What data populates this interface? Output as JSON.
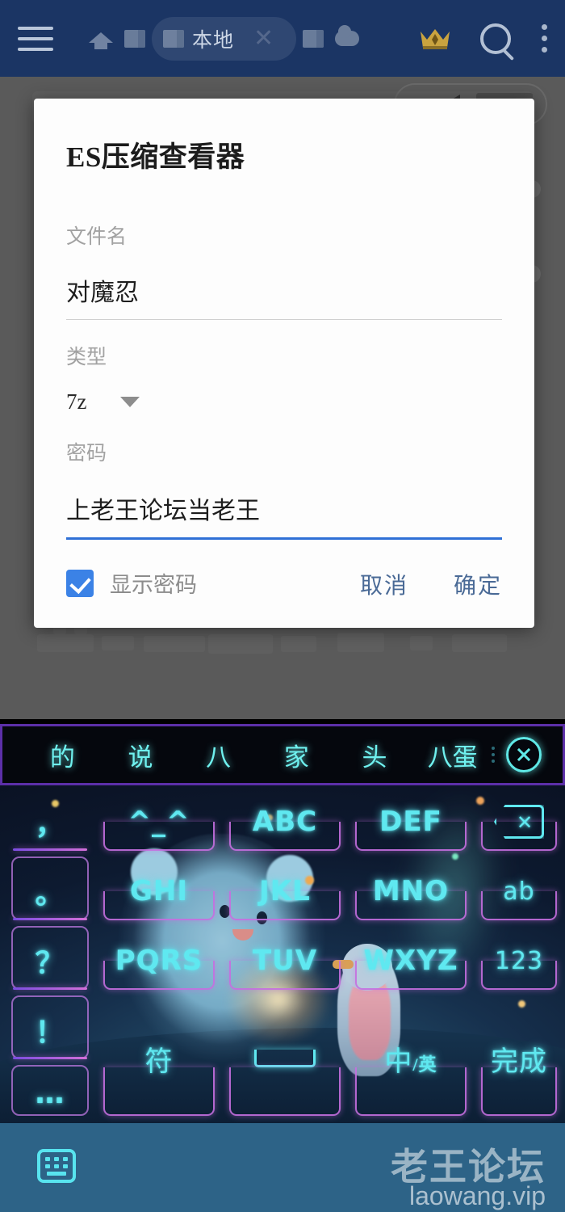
{
  "appbar": {
    "menu_icon": "hamburger-icon",
    "home_icon": "home-icon",
    "tab_icon": "tab-icon",
    "active_tab_label": "本地",
    "close_tab_icon": "close-icon",
    "cloud_icon": "cloud-icon",
    "premium_icon": "crown-icon",
    "search_icon": "search-icon",
    "overflow_icon": "more-vertical-icon",
    "bg_color": "#1b3564"
  },
  "dialog": {
    "title": "ES压缩查看器",
    "filename": {
      "label": "文件名",
      "value": "对魔忍"
    },
    "type": {
      "label": "类型",
      "value": "7z",
      "caret_icon": "chevron-down-icon"
    },
    "password": {
      "label": "密码",
      "value": "上老王论坛当老王"
    },
    "show_password": {
      "label": "显示密码",
      "checked": true,
      "color": "#3b82e6"
    },
    "cancel_label": "取消",
    "confirm_label": "确定",
    "accent_color": "#2f70d6"
  },
  "candidate_bar": {
    "items": [
      "的",
      "说",
      "八",
      "家",
      "头",
      "八蛋"
    ],
    "expand_icon": "more-dots-icon",
    "close_icon": "close-circle-icon",
    "border_color": "#5c2fa8",
    "text_color": "#6ff1ef"
  },
  "keyboard": {
    "accent_color": "#5fe8f0",
    "frame_color": "#c66fe0",
    "left_column": [
      "，",
      "。",
      "？",
      "！",
      "…"
    ],
    "rows": [
      [
        {
          "name": "emoticon-key",
          "label": "^_^"
        },
        {
          "name": "abc-key",
          "label": "ABC"
        },
        {
          "name": "def-key",
          "label": "DEF"
        },
        {
          "name": "backspace-key",
          "label": "backspace-icon"
        }
      ],
      [
        {
          "name": "ghi-key",
          "label": "GHI"
        },
        {
          "name": "jkl-key",
          "label": "JKL"
        },
        {
          "name": "mno-key",
          "label": "MNO"
        },
        {
          "name": "ab-key",
          "label": "ab"
        }
      ],
      [
        {
          "name": "pqrs-key",
          "label": "PQRS"
        },
        {
          "name": "tuv-key",
          "label": "TUV"
        },
        {
          "name": "wxyz-key",
          "label": "WXYZ"
        },
        {
          "name": "numeric-key",
          "label": "123"
        }
      ],
      [
        {
          "name": "symbol-key",
          "label": "符"
        },
        {
          "name": "space-key",
          "label": "space-icon"
        },
        {
          "name": "language-key",
          "label": "中/英"
        },
        {
          "name": "done-key",
          "label": "完成"
        }
      ]
    ],
    "language_cn": "中",
    "language_sep": "/",
    "language_en": "英"
  },
  "bottom_bar": {
    "keyboard_icon": "keyboard-icon",
    "watermark_title": "老王论坛",
    "watermark_url": "laowang.vip",
    "bg_color": "#2d6387"
  }
}
